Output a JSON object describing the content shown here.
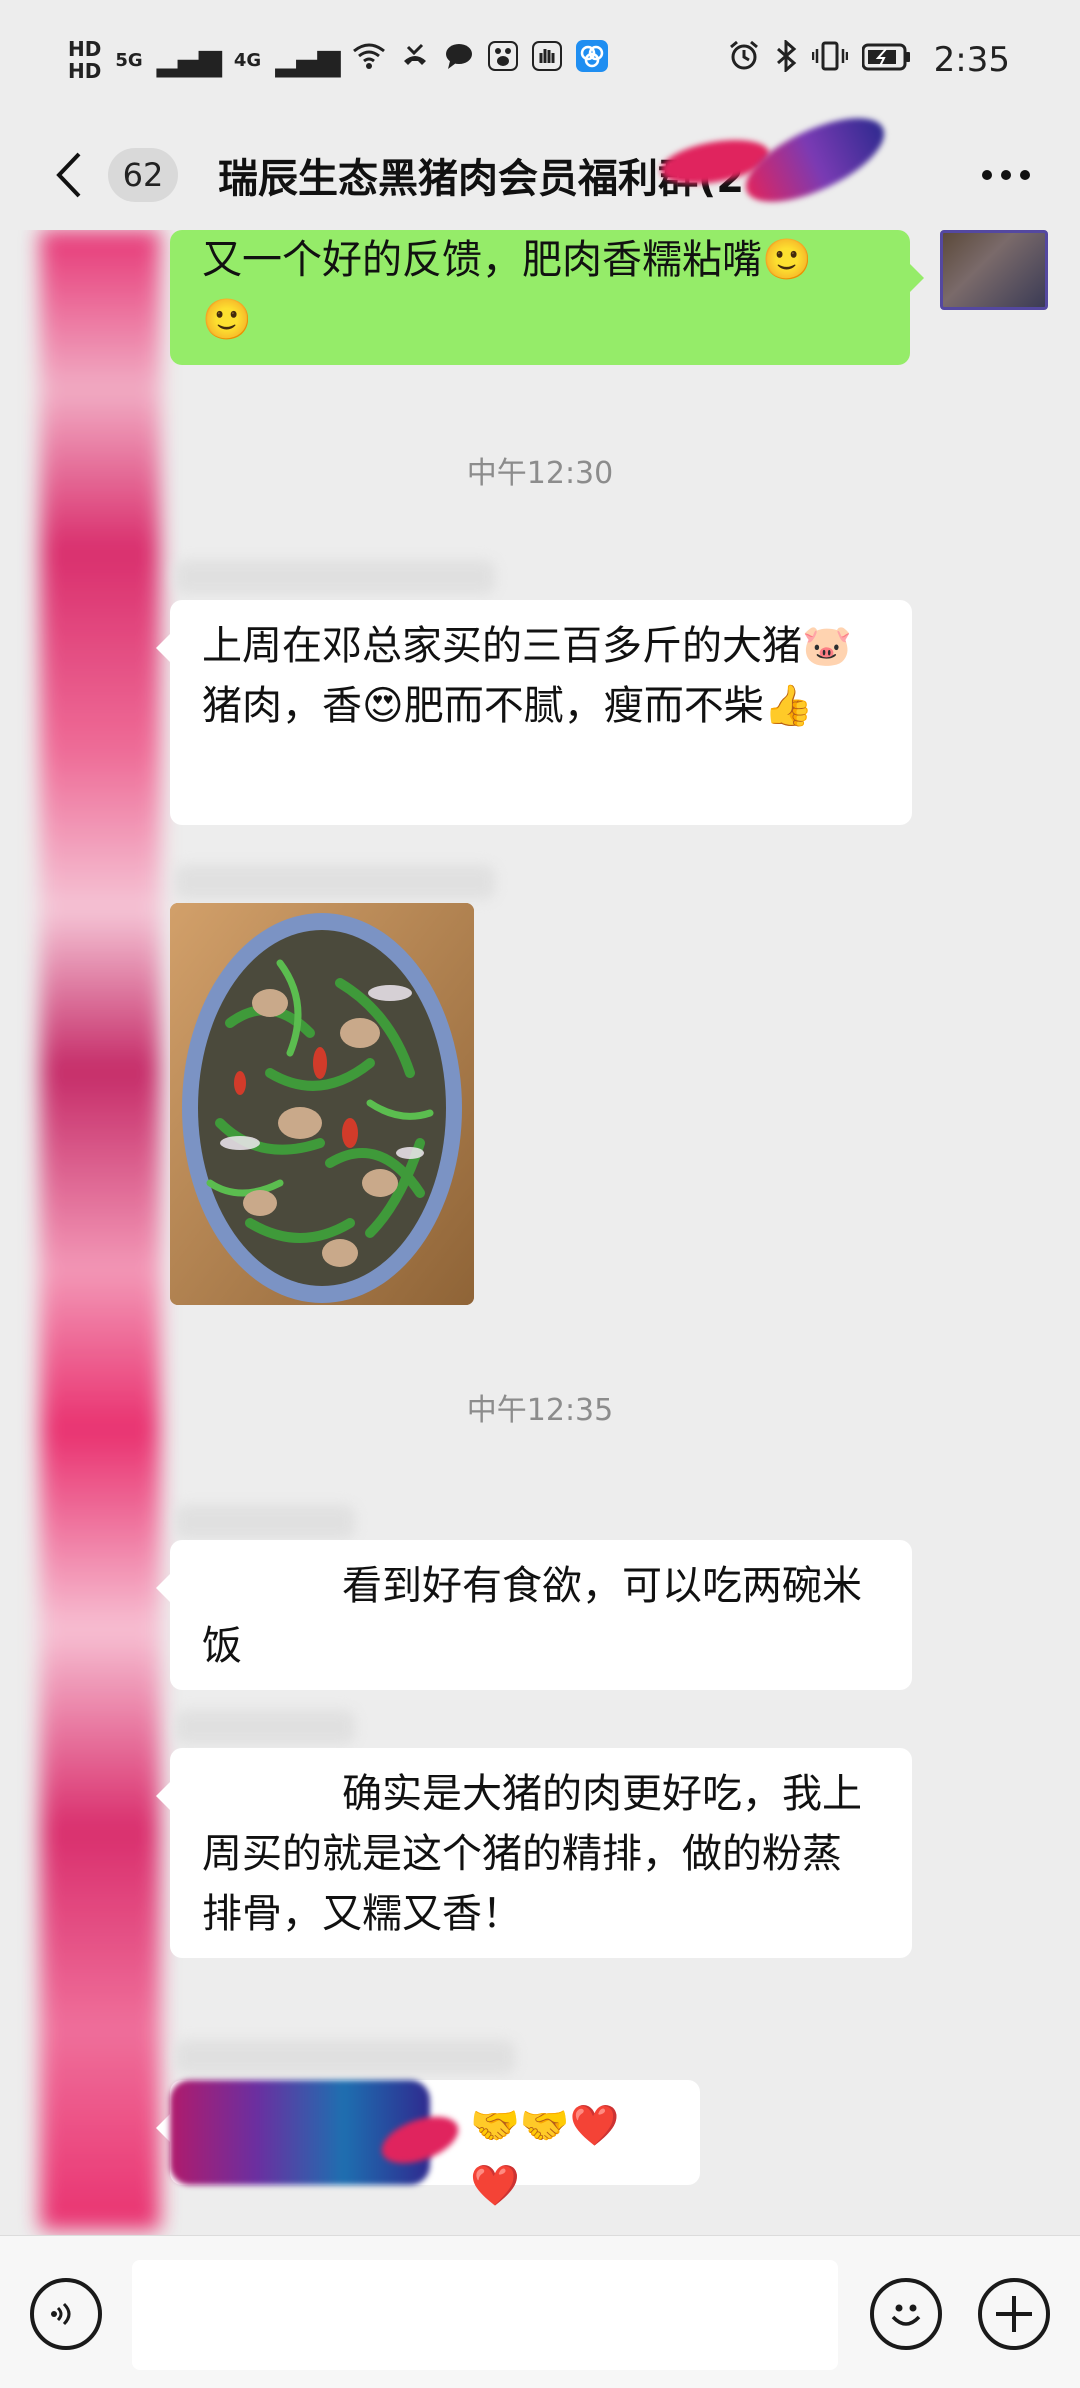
{
  "statusbar": {
    "hd_top": "HD",
    "hd_bottom": "HD",
    "net1": "5G",
    "net2": "4G",
    "time": "2:35"
  },
  "nav": {
    "unread_count": "62",
    "title": "瑞辰生态黑猪肉会员福利群(2"
  },
  "messages": [
    {
      "text_line1": "又一个好的反馈，肥肉香糯粘嘴🙂",
      "text_line2": "🙂"
    },
    {
      "timestamp": "中午12:30"
    },
    {
      "text": "上周在邓总家买的三百多斤的大猪🐷猪肉，香😍肥而不腻，瘦而不柴👍"
    },
    {
      "timestamp": "中午12:35"
    },
    {
      "text": "看到好有食欲，可以吃两碗米饭"
    },
    {
      "text": "确实是大猪的肉更好吃，我上周买的就是这个猪的精排，做的粉蒸排骨，又糯又香！"
    },
    {
      "text": "🤝🤝❤️❤️"
    }
  ],
  "colors": {
    "chat_bg": "#ededed",
    "own_bubble": "#95ec69",
    "other_bubble": "#ffffff",
    "timestamp": "#8c8c8c"
  },
  "icons": [
    "back-chevron-icon",
    "more-dots-icon",
    "voice-icon",
    "emoji-icon",
    "plus-icon"
  ]
}
